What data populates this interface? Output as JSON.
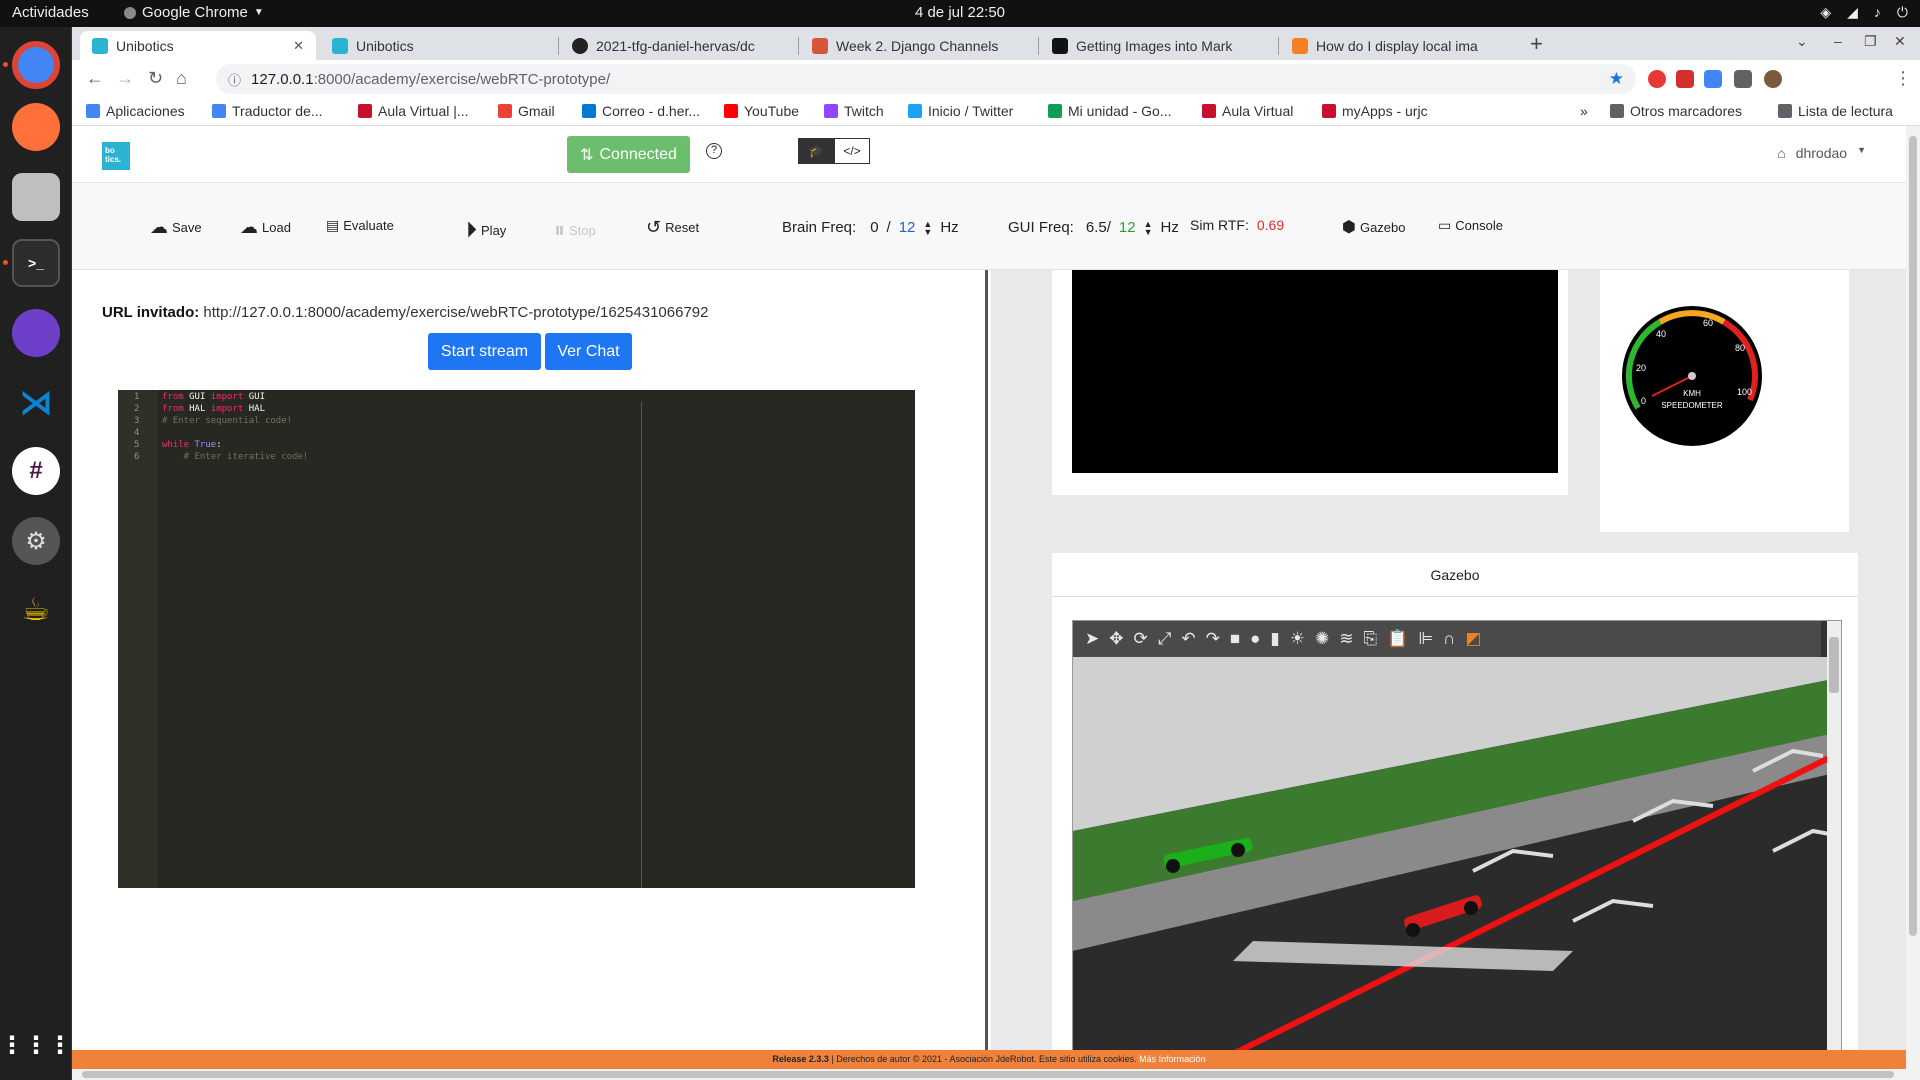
{
  "os": {
    "activities": "Actividades",
    "app_name": "Google Chrome",
    "clock": "4 de jul  22:50"
  },
  "browser": {
    "tabs": [
      {
        "title": "Unibotics",
        "favicon": "unibotics-icon",
        "active": true
      },
      {
        "title": "Unibotics",
        "favicon": "unibotics-icon",
        "active": false
      },
      {
        "title": "2021-tfg-daniel-hervas/dc",
        "favicon": "github-icon",
        "active": false
      },
      {
        "title": "Week 2. Django Channels",
        "favicon": "jderobot-icon",
        "active": false
      },
      {
        "title": "Getting Images into Mark",
        "favicon": "markdown-icon",
        "active": false
      },
      {
        "title": "How do I display local ima",
        "favicon": "stackoverflow-icon",
        "active": false
      }
    ],
    "url_host": "127.0.0.1",
    "url_path": ":8000/academy/exercise/webRTC-prototype/",
    "bookmarks": [
      {
        "label": "Aplicaciones",
        "icon": "apps-grid-icon",
        "color": "#4285f4"
      },
      {
        "label": "Traductor de...",
        "icon": "translate-icon",
        "color": "#4285f4"
      },
      {
        "label": "Aula Virtual |...",
        "icon": "urjc-icon",
        "color": "#c8102e"
      },
      {
        "label": "Gmail",
        "icon": "gmail-icon",
        "color": "#ea4335"
      },
      {
        "label": "Correo - d.her...",
        "icon": "outlook-icon",
        "color": "#0078d4"
      },
      {
        "label": "YouTube",
        "icon": "youtube-icon",
        "color": "#ff0000"
      },
      {
        "label": "Twitch",
        "icon": "twitch-icon",
        "color": "#9146ff"
      },
      {
        "label": "Inicio / Twitter",
        "icon": "twitter-icon",
        "color": "#1da1f2"
      },
      {
        "label": "Mi unidad - Go...",
        "icon": "drive-icon",
        "color": "#0f9d58"
      },
      {
        "label": "Aula Virtual",
        "icon": "urjc-icon",
        "color": "#c8102e"
      },
      {
        "label": "myApps - urjc",
        "icon": "urjc-icon",
        "color": "#c8102e"
      }
    ],
    "bookmarks_more": "»",
    "other_bookmarks": "Otros marcadores",
    "reading_list": "Lista de lectura"
  },
  "navbar": {
    "logo_text": "bo tics.",
    "connected_label": "Connected",
    "connected_color": "#5cb85c",
    "help": "?",
    "user": "dhrodao"
  },
  "toolbar": {
    "save": "Save",
    "load": "Load",
    "evaluate": "Evaluate",
    "play": "Play",
    "stop": "Stop",
    "reset": "Reset",
    "brain_freq_label": "Brain Freq:",
    "brain_freq_current": "0",
    "brain_freq_sep": "/",
    "brain_freq_target": "12",
    "gui_freq_label": "GUI Freq:",
    "gui_freq_current": "6.5/",
    "gui_freq_target": "12",
    "hz": "Hz",
    "sim_rtf_label": "Sim RTF:",
    "sim_rtf_value": "0.69",
    "gazebo": "Gazebo",
    "console": "Console"
  },
  "left_panel": {
    "url_label": "URL invitado:",
    "url_value": "http://127.0.0.1:8000/academy/exercise/webRTC-prototype/1625431066792",
    "start_stream": "Start stream",
    "ver_chat": "Ver Chat",
    "code_lines": [
      {
        "n": "1",
        "text": "from GUI import GUI"
      },
      {
        "n": "2",
        "text": "from HAL import HAL"
      },
      {
        "n": "3",
        "text": "# Enter sequential code!"
      },
      {
        "n": "4",
        "text": ""
      },
      {
        "n": "5",
        "text": "while True:"
      },
      {
        "n": "6",
        "text": "    # Enter iterative code!"
      }
    ]
  },
  "right_panel": {
    "speedometer": {
      "ticks": [
        "0",
        "20",
        "40",
        "60",
        "80",
        "100"
      ],
      "unit": "KMH",
      "label": "SPEEDOMETER",
      "needle_value": 0
    },
    "gazebo_title": "Gazebo"
  },
  "footer": {
    "release": "Release 2.3.3",
    "text": " | Derechos de autor © 2021 - Asociación JdeRobot. Este sitio utiliza cookies. ",
    "more": "Más Información"
  }
}
